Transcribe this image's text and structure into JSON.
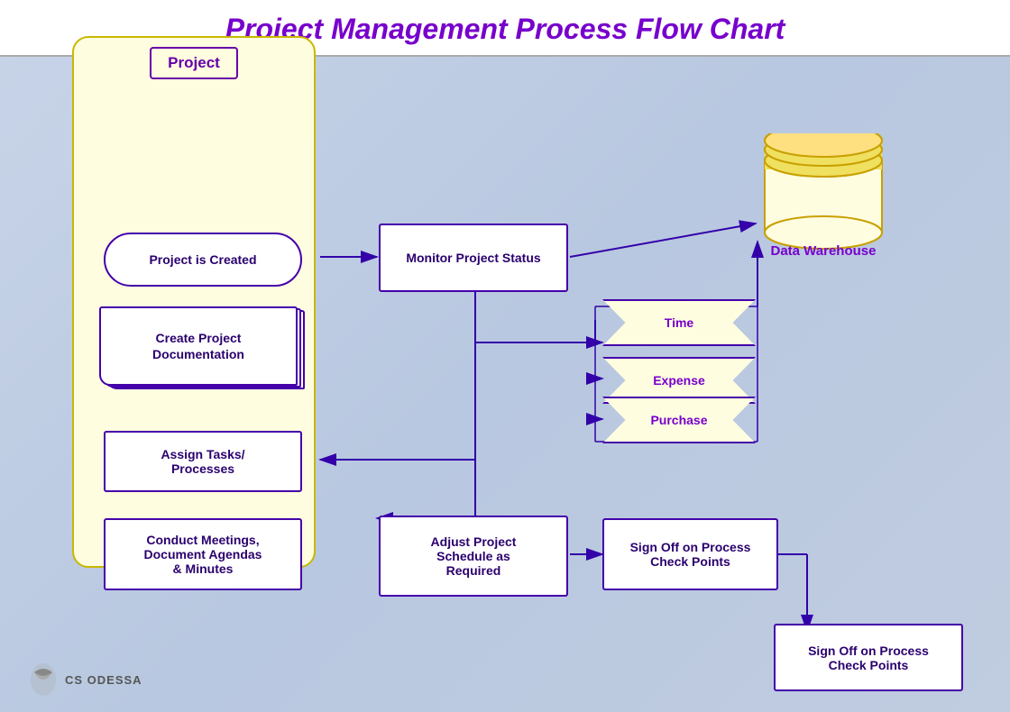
{
  "title": "Project Management Process Flow Chart",
  "lane": {
    "title": "Project"
  },
  "shapes": {
    "project_created": "Project is Created",
    "create_docs": "Create Project\nDocumentation",
    "assign_tasks": "Assign Tasks/\nProcesses",
    "conduct_meetings": "Conduct Meetings,\nDocument Agendas\n& Minutes",
    "monitor_status": "Monitor Project\nStatus",
    "adjust_schedule": "Adjust Project\nSchedule as\nRequired",
    "sign_off_1": "Sign Off on Process\nCheck Points",
    "sign_off_2": "Sign Off on Process\nCheck Points",
    "data_warehouse": "Data\nWarehouse",
    "time": "Time",
    "expense": "Expense",
    "purchase": "Purchase"
  },
  "logo": {
    "text": "CS ODESSA"
  },
  "colors": {
    "title": "#7700cc",
    "border": "#4400aa",
    "text": "#2a006e",
    "accent": "#6600aa",
    "lane_bg": "#fffde0",
    "arrow": "#3300aa"
  }
}
